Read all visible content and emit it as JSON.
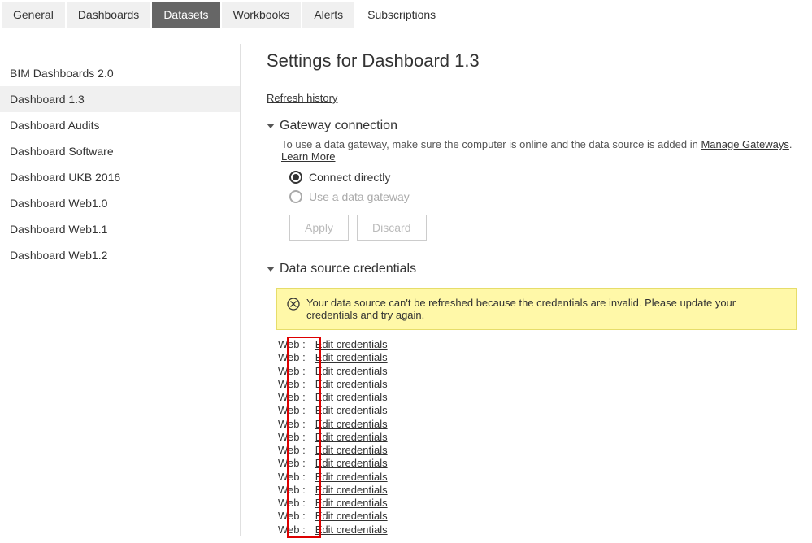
{
  "tabs": {
    "items": [
      {
        "label": "General"
      },
      {
        "label": "Dashboards"
      },
      {
        "label": "Datasets"
      },
      {
        "label": "Workbooks"
      },
      {
        "label": "Alerts"
      },
      {
        "label": "Subscriptions"
      }
    ],
    "activeIndex": 2
  },
  "sidebar": {
    "items": [
      {
        "label": "BIM Dashboards 2.0"
      },
      {
        "label": "Dashboard 1.3"
      },
      {
        "label": "Dashboard Audits"
      },
      {
        "label": "Dashboard Software"
      },
      {
        "label": "Dashboard UKB 2016"
      },
      {
        "label": "Dashboard Web1.0"
      },
      {
        "label": "Dashboard Web1.1"
      },
      {
        "label": "Dashboard Web1.2"
      }
    ],
    "activeIndex": 1
  },
  "content": {
    "title": "Settings for Dashboard 1.3",
    "refreshHistory": "Refresh history",
    "gateway": {
      "header": "Gateway connection",
      "descPrefix": "To use a data gateway, make sure the computer is online and the data source is added in ",
      "manageGateways": "Manage Gateways",
      "descMiddle": ". ",
      "learnMore": "Learn More",
      "option1": "Connect directly",
      "option2": "Use a data gateway",
      "apply": "Apply",
      "discard": "Discard"
    },
    "credentials": {
      "header": "Data source credentials",
      "warning": "Your data source can't be refreshed because the credentials are invalid. Please update your credentials and try again.",
      "sourceLabel": "Web :",
      "editLabel": "Edit credentials",
      "count": 15
    }
  }
}
